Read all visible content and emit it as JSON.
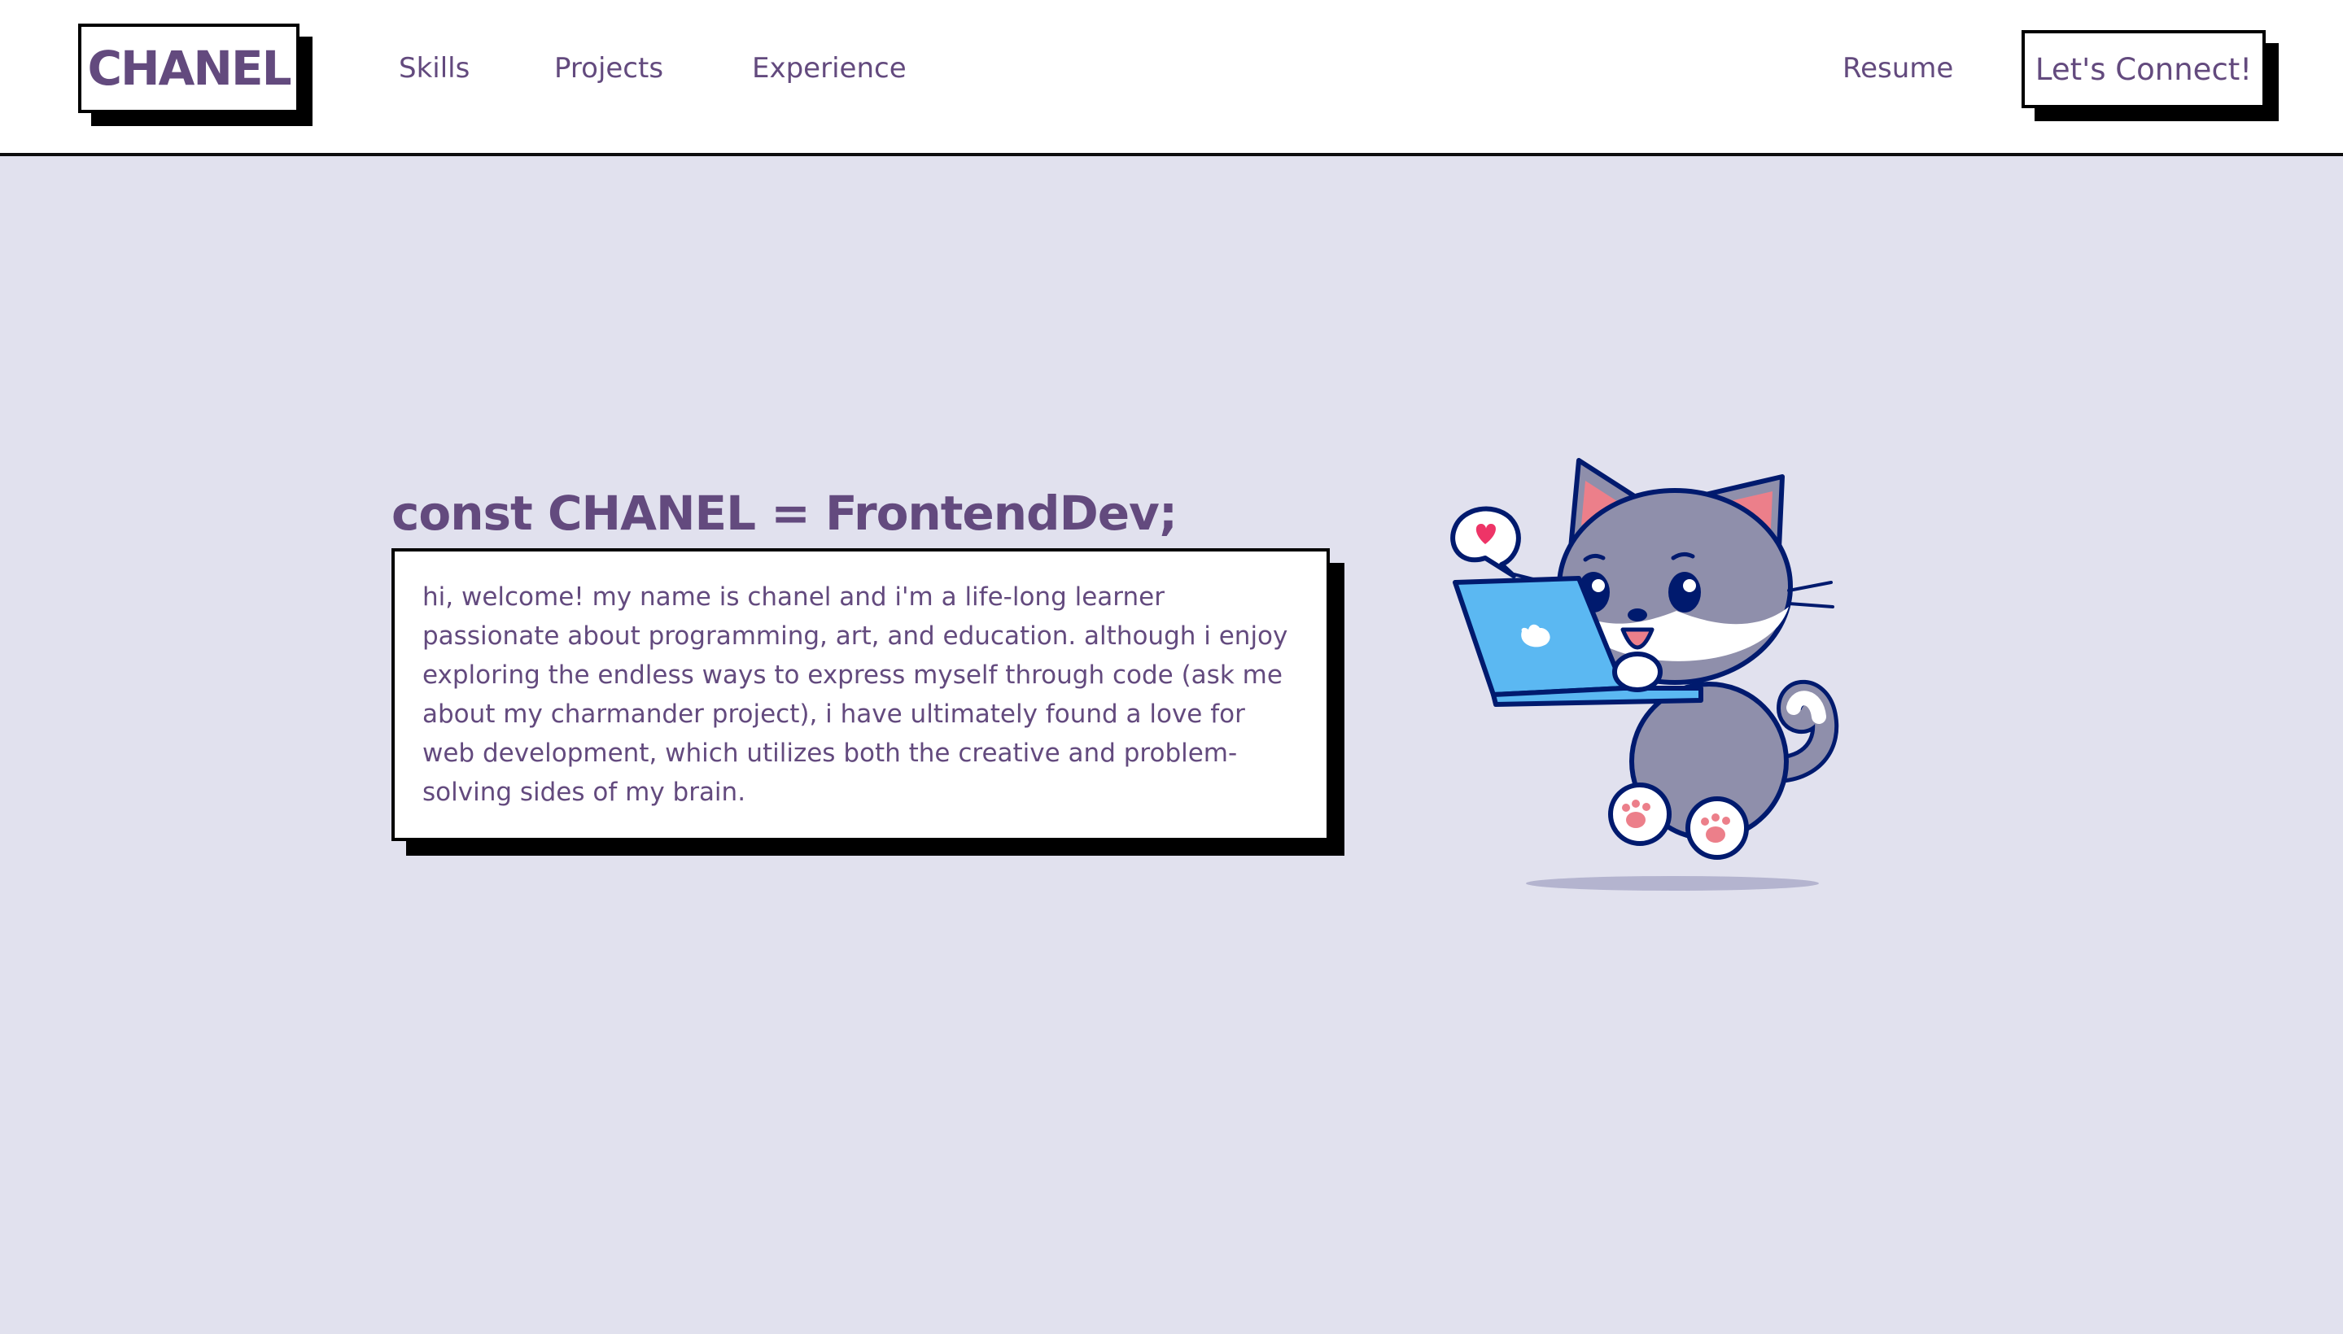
{
  "header": {
    "logo": "CHANEL",
    "nav": {
      "skills": "Skills",
      "projects": "Projects",
      "experience": "Experience",
      "resume": "Resume"
    },
    "cta": "Let's Connect!"
  },
  "hero": {
    "title": "const CHANEL = FrontendDev;",
    "intro": "hi, welcome! my name is chanel and i'm a life-long learner passionate about programming, art, and education. although i enjoy exploring the endless ways to express myself through code (ask me about my charmander project), i have ultimately found a love for web development, which utilizes both the creative and problem-solving sides of my brain.",
    "illustration": "cat-with-laptop-illustration"
  },
  "colors": {
    "background": "#e1e1ee",
    "header_bg": "#ffffff",
    "text_purple": "#634a7e",
    "border": "#000000",
    "cat_gray": "#8f8fab",
    "laptop_blue": "#5bb8f2",
    "heart_pink": "#ee3467"
  }
}
